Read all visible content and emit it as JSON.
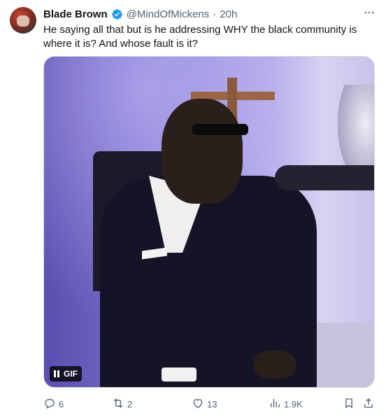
{
  "tweet": {
    "author_name": "Blade Brown",
    "handle": "@MindOfMickens",
    "separator": "·",
    "time": "20h",
    "text": "He saying all that but is he addressing WHY the black community is where it is? And whose fault is it?",
    "verified": true,
    "media": {
      "type": "gif",
      "badge_label": "GIF",
      "play_state_icon": "pause-icon"
    },
    "stats": {
      "replies": "6",
      "reposts": "2",
      "likes": "13",
      "views": "1.9K"
    },
    "icons": {
      "verified": "verified-badge-icon",
      "more": "more-icon",
      "reply": "reply-icon",
      "repost": "repost-icon",
      "like": "heart-icon",
      "views": "views-icon",
      "bookmark": "bookmark-icon",
      "share": "share-icon"
    },
    "colors": {
      "verified": "#1d9bf0",
      "text": "#0f1419",
      "muted": "#536471"
    }
  }
}
